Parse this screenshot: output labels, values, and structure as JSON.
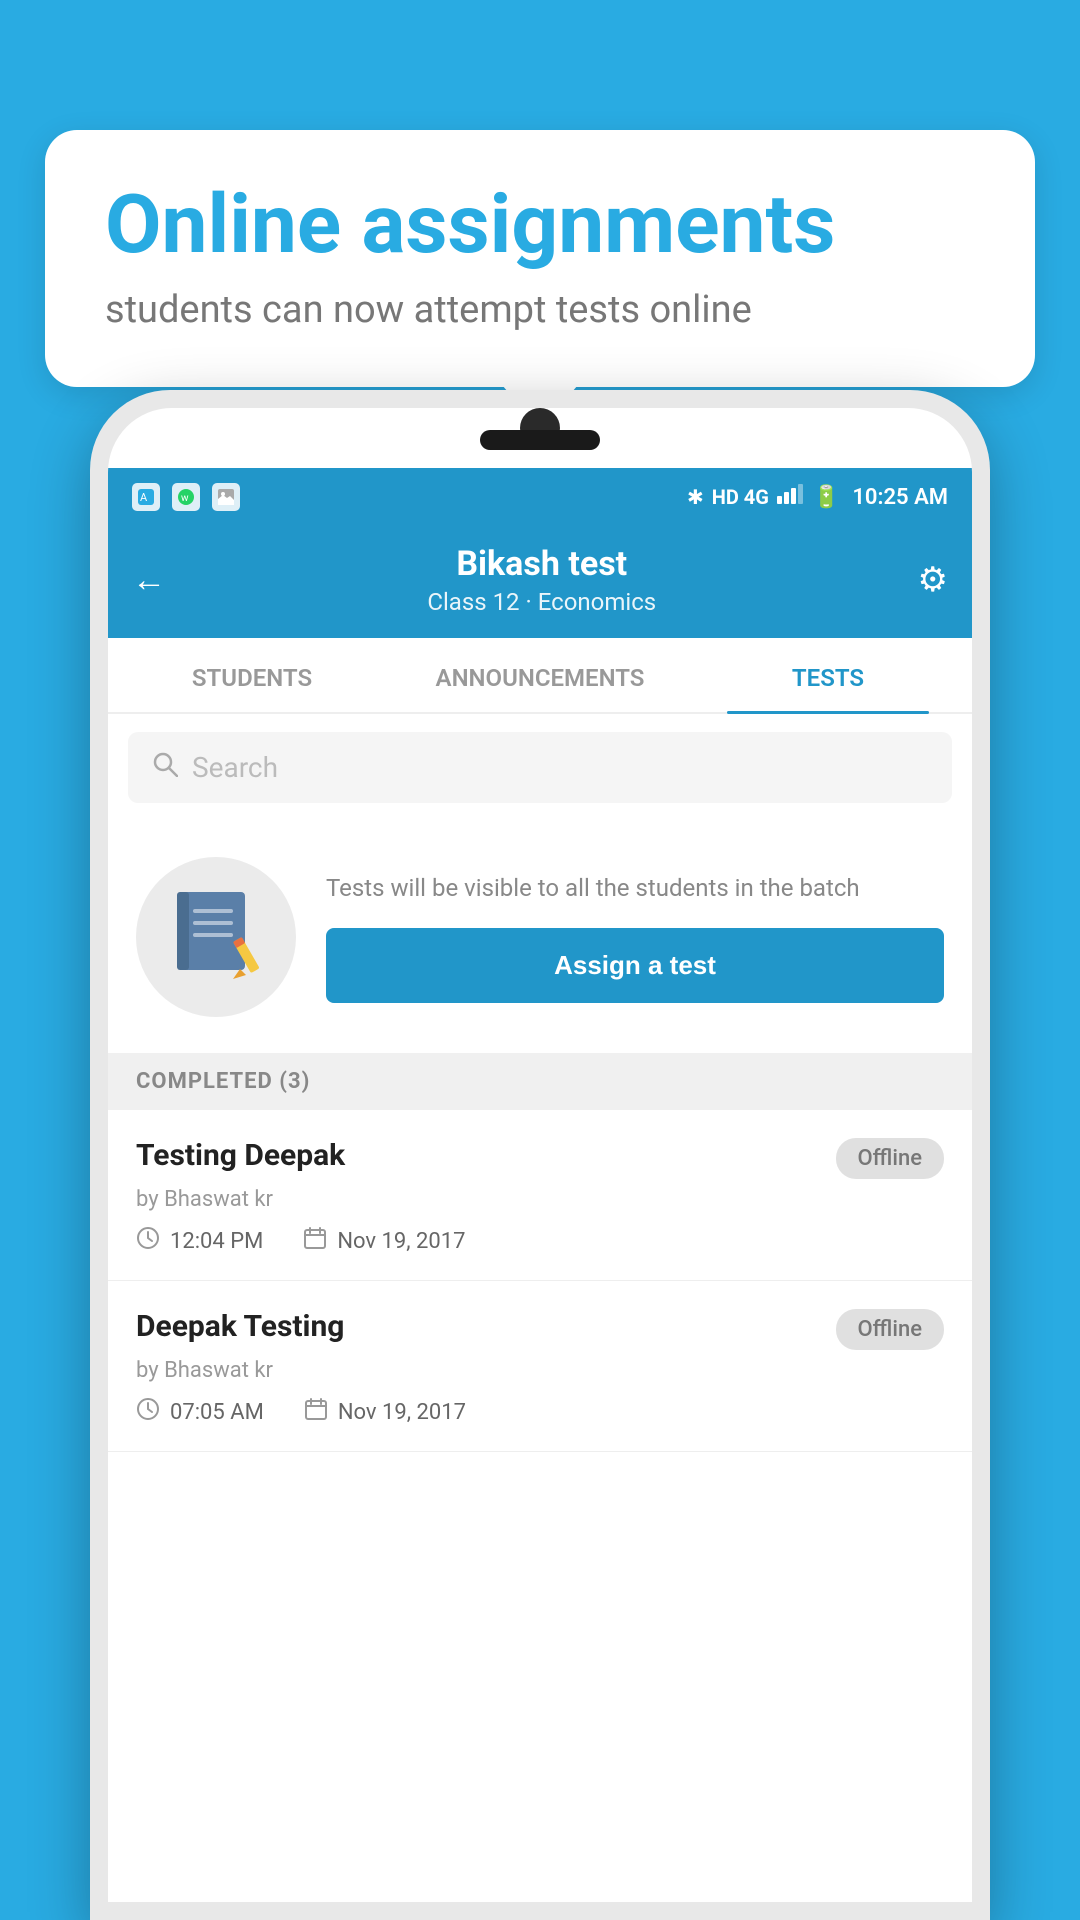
{
  "background_color": "#29ABE2",
  "bubble": {
    "title": "Online assignments",
    "subtitle": "students can now attempt tests online"
  },
  "status_bar": {
    "time": "10:25 AM",
    "network": "HD 4G",
    "icons": [
      "app1",
      "whatsapp",
      "image"
    ]
  },
  "header": {
    "title": "Bikash test",
    "subtitle": "Class 12 · Economics",
    "back_label": "←",
    "settings_label": "⚙"
  },
  "tabs": [
    {
      "label": "STUDENTS",
      "active": false
    },
    {
      "label": "ANNOUNCEMENTS",
      "active": false
    },
    {
      "label": "TESTS",
      "active": true
    }
  ],
  "search": {
    "placeholder": "Search"
  },
  "assign": {
    "info_text": "Tests will be visible to all the students in the batch",
    "button_label": "Assign a test"
  },
  "completed_section": {
    "header": "COMPLETED (3)"
  },
  "test_items": [
    {
      "name": "Testing Deepak",
      "author": "by Bhaswat kr",
      "badge": "Offline",
      "time": "12:04 PM",
      "date": "Nov 19, 2017"
    },
    {
      "name": "Deepak Testing",
      "author": "by Bhaswat kr",
      "badge": "Offline",
      "time": "07:05 AM",
      "date": "Nov 19, 2017"
    }
  ]
}
